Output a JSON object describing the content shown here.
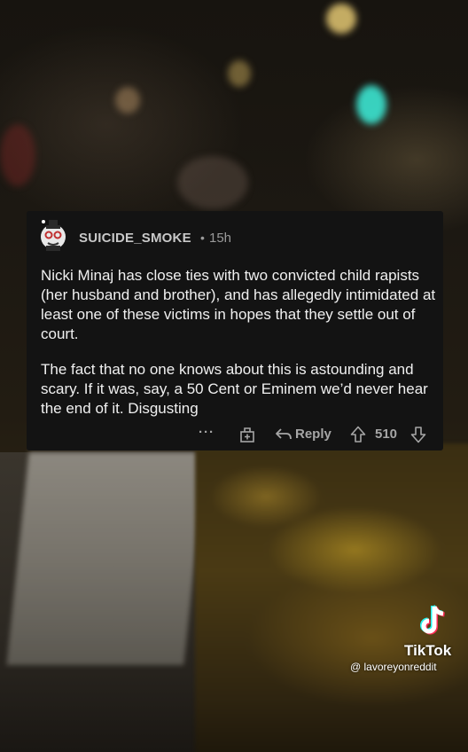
{
  "comment": {
    "username": "SUICIDE_SMOKE",
    "separator": "•",
    "age": "15h",
    "paragraphs": [
      "Nicki Minaj has close ties with two convicted child rapists (her husband and brother), and has allegedly intimidated at least one of these victims in hopes that they settle out of court.",
      "The fact that no one knows about this is astounding and scary. If it was, say, a 50 Cent or Eminem we’d never hear the end of it. Disgusting"
    ],
    "actions": {
      "more": "···",
      "reply_label": "Reply",
      "score": "510"
    }
  },
  "watermark": {
    "app_name": "TikTok",
    "handle": "@ lavoreyonreddit"
  },
  "icons": {
    "avatar": "snoo-avatar-icon",
    "award": "award-icon",
    "reply": "reply-arrow-icon",
    "upvote": "upvote-arrow-icon",
    "downvote": "downvote-arrow-icon",
    "logo": "tiktok-logo-icon"
  },
  "colors": {
    "card_background": "#131313",
    "username": "#c8c8c8",
    "meta_text": "#9a9a9a",
    "body_text": "#f0f0f0",
    "action_text": "#a6a6a6"
  }
}
